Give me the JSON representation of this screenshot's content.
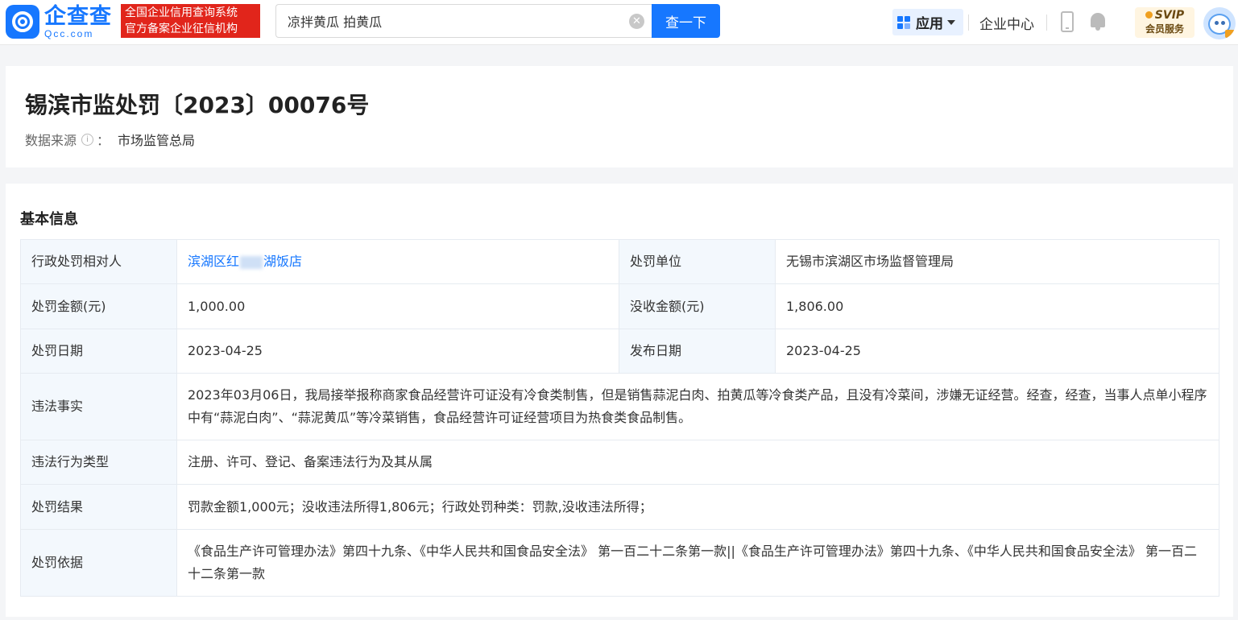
{
  "header": {
    "logo_cn": "企查查",
    "logo_en": "Qcc.com",
    "badge_line1": "全国企业信用查询系统",
    "badge_line2": "官方备案企业征信机构",
    "search_value": "凉拌黄瓜 拍黄瓜",
    "clear_glyph": "✕",
    "search_button": "查一下",
    "apps_label": "应用",
    "corp_center": "企业中心",
    "vip_title": "SVIP",
    "vip_sub": "会员服务"
  },
  "record": {
    "title": "锡滨市监处罚〔2023〕00076号",
    "source_label": "数据来源",
    "info_glyph": "i",
    "source_colon": "：",
    "source_value": "市场监管总局"
  },
  "basic": {
    "heading": "基本信息",
    "party_label": "行政处罚相对人",
    "party_prefix": "滨湖区红",
    "party_suffix": "湖饭店",
    "unit_label": "处罚单位",
    "unit_value": "无锡市滨湖区市场监督管理局",
    "fine_label": "处罚金额(元)",
    "fine_value": "1,000.00",
    "confiscate_label": "没收金额(元)",
    "confiscate_value": "1,806.00",
    "date_label": "处罚日期",
    "date_value": "2023-04-25",
    "publish_label": "发布日期",
    "publish_value": "2023-04-25",
    "facts_label": "违法事实",
    "facts_value": "2023年03月06日，我局接举报称商家食品经营许可证没有冷食类制售，但是销售蒜泥白肉、拍黄瓜等冷食类产品，且没有冷菜间，涉嫌无证经营。经查，经查，当事人点单小程序中有“蒜泥白肉”、“蒜泥黄瓜”等冷菜销售，食品经营许可证经营项目为热食类食品制售。",
    "type_label": "违法行为类型",
    "type_value": "注册、许可、登记、备案违法行为及其从属",
    "result_label": "处罚结果",
    "result_value": "罚款金额1,000元；没收违法所得1,806元；行政处罚种类：罚款,没收违法所得；",
    "basis_label": "处罚依据",
    "basis_value": "《食品生产许可管理办法》第四十九条、《中华人民共和国食品安全法》 第一百二十二条第一款||《食品生产许可管理办法》第四十九条、《中华人民共和国食品安全法》 第一百二十二条第一款"
  }
}
